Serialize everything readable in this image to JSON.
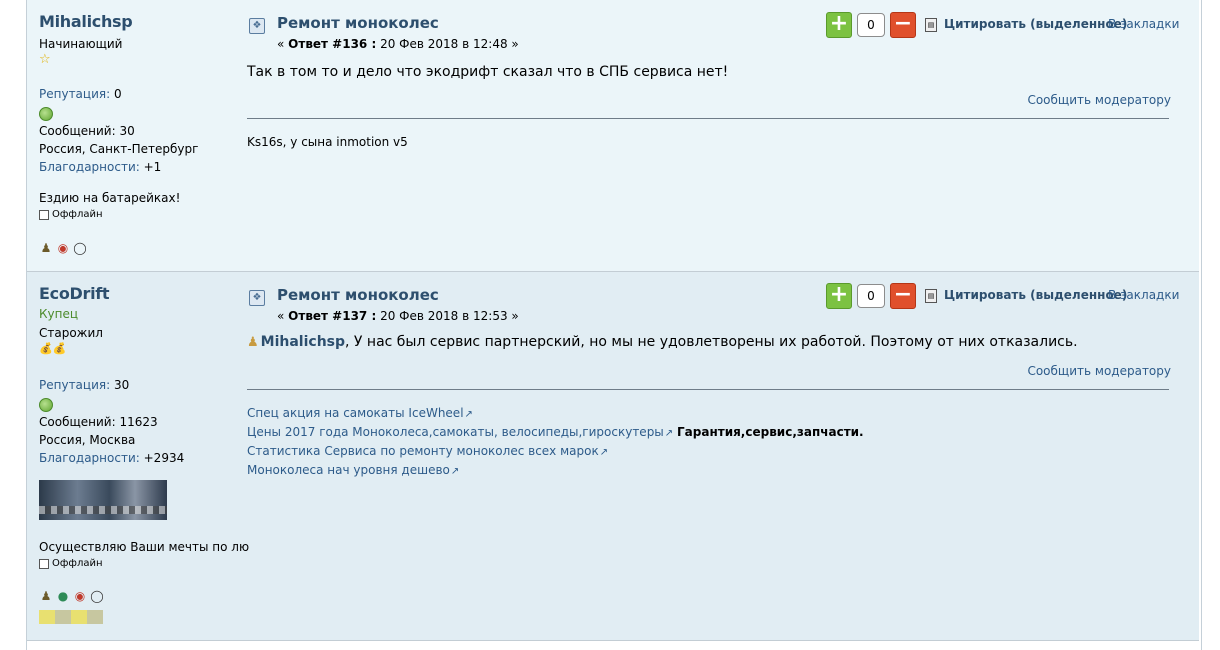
{
  "posts": [
    {
      "username": "Mihalichsp",
      "rank": "Начинающий",
      "stars": "☆",
      "reputation_label": "Репутация:",
      "reputation_value": "0",
      "messages_label": "Сообщений:",
      "messages_value": "30",
      "location": "Россия, Санкт-Петербург",
      "thanks_label": "Благодарности:",
      "thanks_value": "+1",
      "personal_text": "Ездию на батарейках!",
      "status": "Оффлайн",
      "subject": "Ремонт моноколес",
      "reply_prefix": "« ",
      "reply_num": "Ответ #136 :",
      "reply_date": " 20 Фев 2018 в 12:48 »",
      "vote_count": "0",
      "quote_label": "Цитировать",
      "quote_sel": "(выделенное)",
      "bookmark": "В закладки",
      "body": "Так в том то и дело что экодрифт сказал что в СПБ сервиса нет!",
      "report": "Сообщить модератору",
      "signature": "Ks16s, у сына inmotion v5"
    },
    {
      "username": "EcoDrift",
      "member_group": "Купец",
      "rank": "Старожил",
      "stars": "💰💰",
      "reputation_label": "Репутация:",
      "reputation_value": "30",
      "messages_label": "Сообщений:",
      "messages_value": "11623",
      "location": "Россия, Москва",
      "thanks_label": "Благодарности:",
      "thanks_value": "+2934",
      "personal_text": "Осуществляю Ваши мечты по любо",
      "status": "Оффлайн",
      "subject": "Ремонт моноколес",
      "reply_prefix": "« ",
      "reply_num": "Ответ #137 :",
      "reply_date": " 20 Фев 2018 в 12:53 »",
      "vote_count": "0",
      "quote_label": "Цитировать",
      "quote_sel": "(выделенное)",
      "bookmark": "В закладки",
      "quoted_user": "Mihalichsp",
      "body": ", У нас был сервис партнерский, но мы не удовлетворены их работой. Поэтому от них отказались.",
      "report": "Сообщить модератору",
      "sig_links": [
        "Спец акция на самокаты IceWheel",
        "Цены 2017 года Моноколеса,самокаты, велосипеды,гироскутеры",
        "Статистика Сервиса по ремонту моноколес всех марок",
        "Моноколеса нач уровня дешево"
      ],
      "sig_bold": "Гарантия,сервис,запчасти."
    }
  ],
  "icons": {
    "topic": "topic-icon",
    "plus": "plus-icon",
    "minus": "minus-icon",
    "quote": "quote-icon",
    "user": "user-icon",
    "external": "external-link-icon",
    "profile": "profile-icon",
    "medal": "medal-icon",
    "message": "speech-bubble-icon",
    "globe": "globe-icon"
  }
}
